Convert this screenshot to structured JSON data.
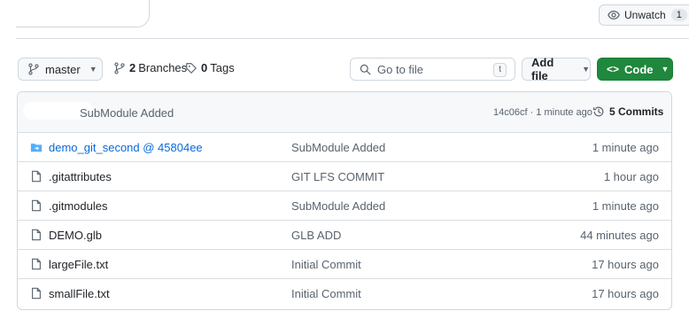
{
  "header": {
    "unwatch_label": "Unwatch",
    "unwatch_count": "1"
  },
  "toolbar": {
    "branch": "master",
    "branches_count": "2",
    "branches_label": "Branches",
    "tags_count": "0",
    "tags_label": "Tags",
    "search_placeholder": "Go to file",
    "search_shortcut": "t",
    "add_file_label": "Add file",
    "code_label": "Code"
  },
  "latest_commit": {
    "message": "SubModule Added",
    "meta": "14c06cf · 1 minute ago",
    "commits_label": "5 Commits"
  },
  "files": [
    {
      "name": "demo_git_second @ 45804ee",
      "message": "SubModule Added",
      "time": "1 minute ago",
      "icon": "submodule-folder-icon"
    },
    {
      "name": ".gitattributes",
      "message": "GIT LFS COMMIT",
      "time": "1 hour ago",
      "icon": "file-icon"
    },
    {
      "name": ".gitmodules",
      "message": "SubModule Added",
      "time": "1 minute ago",
      "icon": "file-icon"
    },
    {
      "name": "DEMO.glb",
      "message": "GLB ADD",
      "time": "44 minutes ago",
      "icon": "file-icon"
    },
    {
      "name": "largeFile.txt",
      "message": "Initial Commit",
      "time": "17 hours ago",
      "icon": "file-icon"
    },
    {
      "name": "smallFile.txt",
      "message": "Initial Commit",
      "time": "17 hours ago",
      "icon": "file-icon"
    }
  ],
  "colors": {
    "accent_green": "#1f883d",
    "link_blue": "#0969da",
    "folder_blue": "#54aeff"
  }
}
